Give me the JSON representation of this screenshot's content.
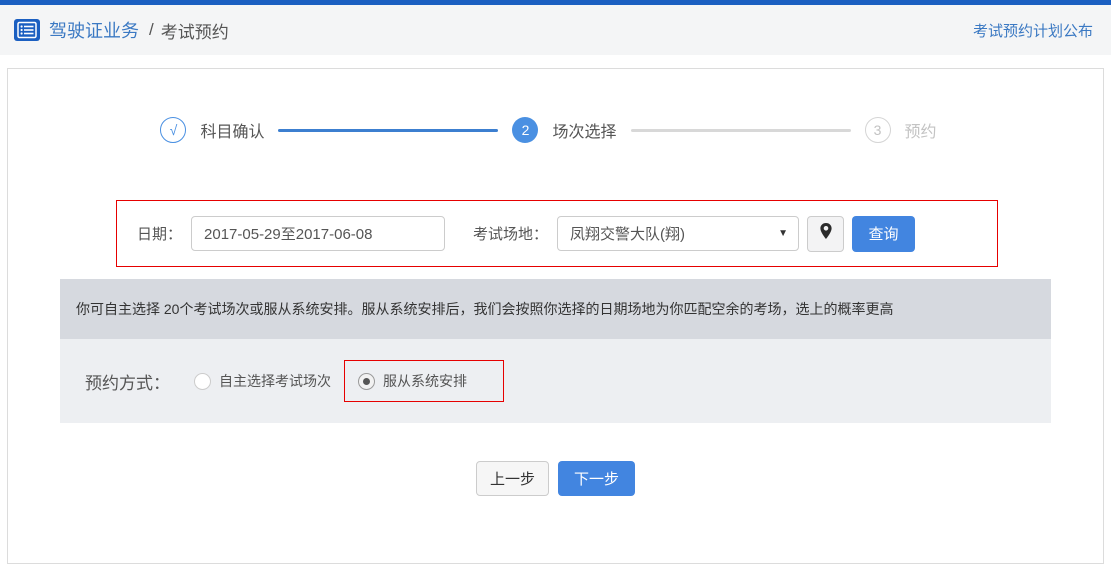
{
  "header": {
    "breadcrumb_primary": "驾驶证业务",
    "breadcrumb_separator": "/",
    "breadcrumb_current": "考试预约",
    "plan_link": "考试预约计划公布"
  },
  "stepper": {
    "steps": [
      {
        "marker": "√",
        "label": "科目确认",
        "state": "done"
      },
      {
        "marker": "2",
        "label": "场次选择",
        "state": "active"
      },
      {
        "marker": "3",
        "label": "预约",
        "state": "pending"
      }
    ]
  },
  "form": {
    "date_label": "日期：",
    "date_value": "2017-05-29至2017-06-08",
    "venue_label": "考试场地：",
    "venue_value": "凤翔交警大队(翔)",
    "dropdown_arrow": "▼",
    "search_button": "查询"
  },
  "notice": "你可自主选择 20个考试场次或服从系统安排。服从系统安排后，我们会按照你选择的日期场地为你匹配空余的考场，选上的概率更高",
  "booking": {
    "label": "预约方式：",
    "options": [
      {
        "label": "自主选择考试场次",
        "selected": false
      },
      {
        "label": "服从系统安排",
        "selected": true
      }
    ]
  },
  "actions": {
    "prev": "上一步",
    "next": "下一步"
  },
  "colors": {
    "brand": "#1b5fc1",
    "accent": "#3b79c3",
    "btn": "#4285e0",
    "stepblue": "#4a90e2",
    "lineblue": "#3c7fd0",
    "noticebg": "#d6d9df",
    "sectionbg": "#edeff2",
    "red": "#e60000"
  }
}
